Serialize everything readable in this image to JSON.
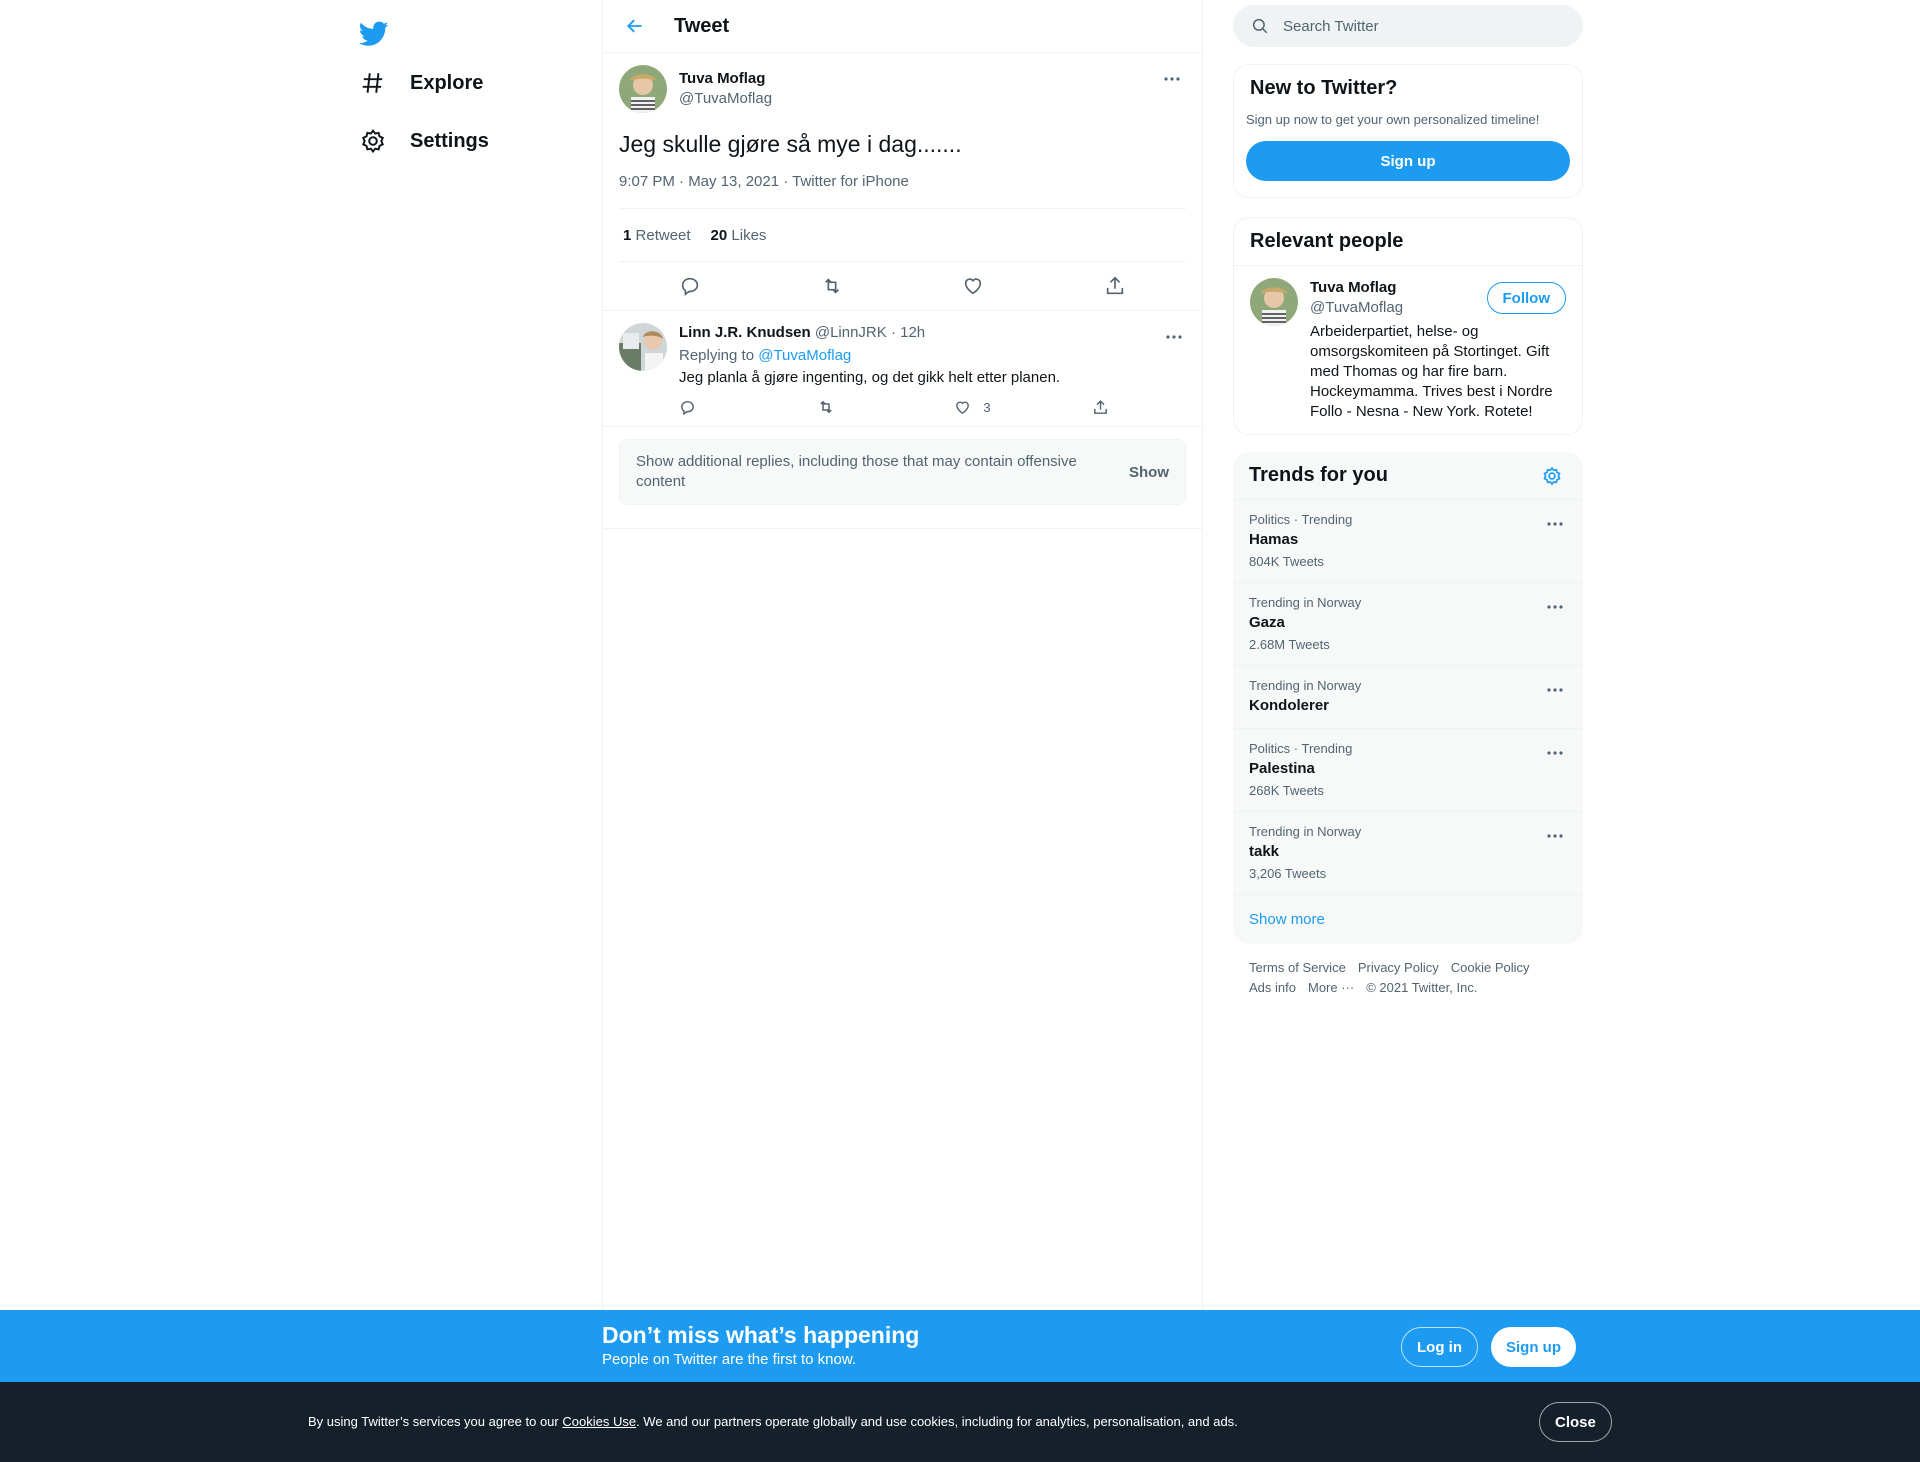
{
  "nav": {
    "items": [
      {
        "label": "Explore",
        "icon": "hashtag-icon"
      },
      {
        "label": "Settings",
        "icon": "gear-icon"
      }
    ]
  },
  "header": {
    "title": "Tweet"
  },
  "tweet": {
    "author_name": "Tuva Moflag",
    "author_handle": "@TuvaMoflag",
    "text": "Jeg skulle gjøre så mye i dag.......",
    "meta": "9:07 PM · May 13, 2021 · Twitter for iPhone",
    "retweets_count": "1",
    "retweets_label": "Retweet",
    "likes_count": "20",
    "likes_label": "Likes"
  },
  "reply": {
    "name": "Linn J.R. Knudsen",
    "handle": "@LinnJRK",
    "time": "· 12h",
    "replying_prefix": "Replying to",
    "replying_to": "@TuvaMoflag",
    "text": "Jeg planla å gjøre ingenting, og det gikk helt etter planen.",
    "likes": "3"
  },
  "additional_replies": {
    "text": "Show additional replies, including those that may contain offensive content",
    "button": "Show"
  },
  "search": {
    "placeholder": "Search Twitter"
  },
  "new_to_twitter": {
    "title": "New to Twitter?",
    "subtitle": "Sign up now to get your own personalized timeline!",
    "button": "Sign up"
  },
  "relevant_people": {
    "title": "Relevant people",
    "name": "Tuva Moflag",
    "handle": "@TuvaMoflag",
    "follow": "Follow",
    "bio": "Arbeiderpartiet, helse- og omsorgskomiteen på Stortinget. Gift med Thomas og har fire barn. Hockeymamma. Trives best i Nordre Follo - Nesna - New York. Rotete!"
  },
  "trends": {
    "title": "Trends for you",
    "items": [
      {
        "category": "Politics · Trending",
        "name": "Hamas",
        "count": "804K Tweets"
      },
      {
        "category": "Trending in Norway",
        "name": "Gaza",
        "count": "2.68M Tweets"
      },
      {
        "category": "Trending in Norway",
        "name": "Kondolerer",
        "count": ""
      },
      {
        "category": "Politics · Trending",
        "name": "Palestina",
        "count": "268K Tweets"
      },
      {
        "category": "Trending in Norway",
        "name": "takk",
        "count": "3,206 Tweets"
      }
    ],
    "show_more": "Show more"
  },
  "footer": {
    "links": [
      "Terms of Service",
      "Privacy Policy",
      "Cookie Policy",
      "Ads info",
      "More ···",
      "© 2021 Twitter, Inc."
    ]
  },
  "bottom_bar": {
    "title": "Don’t miss what’s happening",
    "subtitle": "People on Twitter are the first to know.",
    "login": "Log in",
    "signup": "Sign up"
  },
  "cookie_bar": {
    "prefix": "By using Twitter’s services you agree to our ",
    "link": "Cookies Use",
    "suffix": ". We and our partners operate globally and use cookies, including for analytics, personalisation, and ads.",
    "close": "Close"
  },
  "colors": {
    "accent": "#1d9bf0",
    "text": "#0f1419",
    "muted": "#536471",
    "cookie_bg": "#15202b"
  }
}
